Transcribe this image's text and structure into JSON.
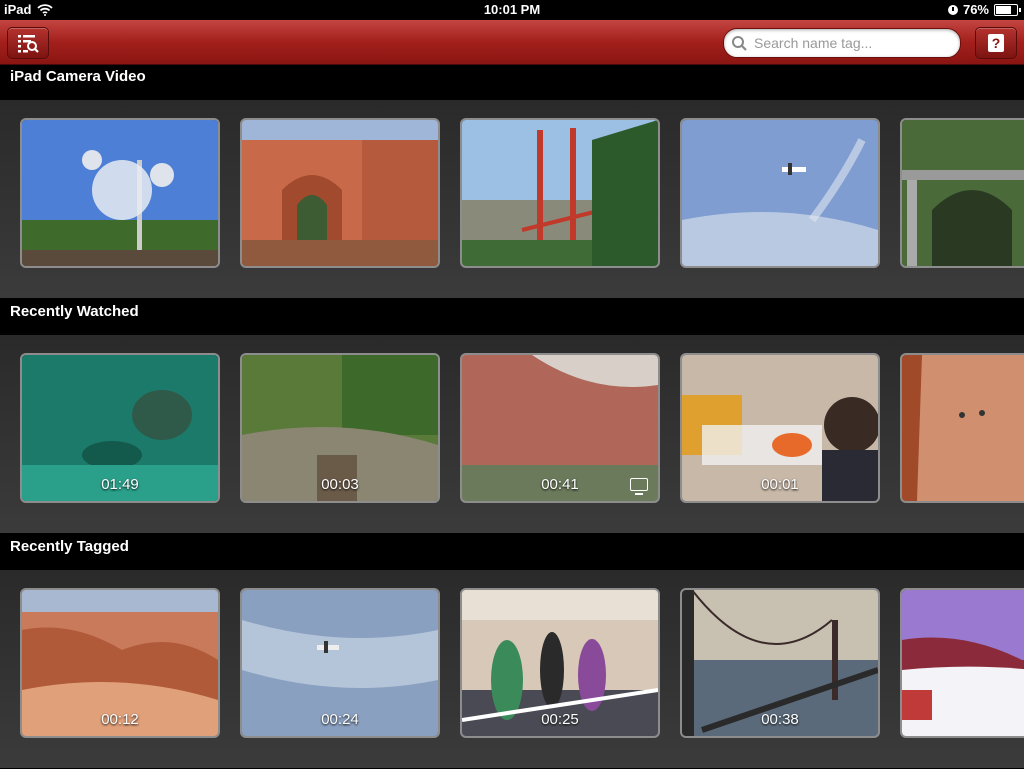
{
  "status_bar": {
    "device": "iPad",
    "time": "10:01 PM",
    "battery": "76%",
    "battery_level": 0.76
  },
  "toolbar": {
    "search_placeholder": "Search name tag...",
    "left_button_icon": "list-search-icon",
    "right_button_icon": "help-icon",
    "help_glyph": "?"
  },
  "sections": [
    {
      "title": "iPad Camera Video",
      "items": [
        {
          "scene": "sculpture-sky",
          "duration": ""
        },
        {
          "scene": "red-rock-arch",
          "duration": ""
        },
        {
          "scene": "golden-gate",
          "duration": ""
        },
        {
          "scene": "plane-sky",
          "duration": ""
        },
        {
          "scene": "stone-bridge",
          "duration": ""
        }
      ]
    },
    {
      "title": "Recently Watched",
      "items": [
        {
          "scene": "underwater",
          "duration": "01:49"
        },
        {
          "scene": "forest-creek",
          "duration": "00:03"
        },
        {
          "scene": "canyon-wall",
          "duration": "00:41",
          "tv_icon": true
        },
        {
          "scene": "kitchen-people",
          "duration": "00:01"
        },
        {
          "scene": "canyon-hikers",
          "duration": ""
        }
      ]
    },
    {
      "title": "Recently Tagged",
      "items": [
        {
          "scene": "hoodoos",
          "duration": "00:12"
        },
        {
          "scene": "plane-clouds",
          "duration": "00:24"
        },
        {
          "scene": "costume-parade",
          "duration": "00:25"
        },
        {
          "scene": "bridge-sunset",
          "duration": "00:38"
        },
        {
          "scene": "snow-slope",
          "duration": ""
        }
      ]
    }
  ],
  "colors": {
    "toolbar_red": "#a3201c",
    "band_gray": "#333333"
  }
}
